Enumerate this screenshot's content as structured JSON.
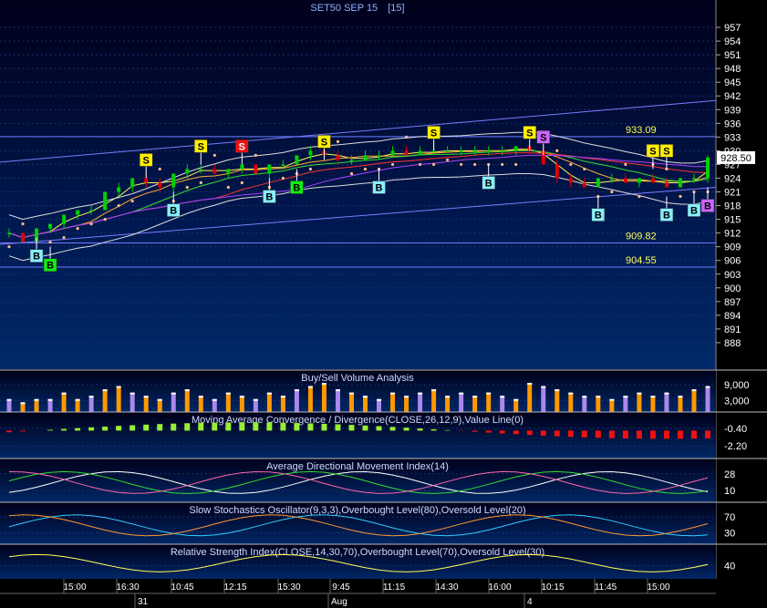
{
  "chart_data": {
    "type": "candlestick",
    "title": "SET50 SEP 15",
    "interval": "[15]",
    "last_price": "928.50",
    "price_axis": {
      "range": [
        884,
        960
      ],
      "ticks": [
        "957",
        "954",
        "951",
        "948",
        "945",
        "942",
        "939",
        "936",
        "933",
        "930",
        "927",
        "924",
        "921",
        "918",
        "915",
        "912",
        "909",
        "906",
        "903",
        "900",
        "897",
        "894",
        "891",
        "888"
      ]
    },
    "levels": [
      {
        "label": "933.09",
        "value": 933.09
      },
      {
        "label": "909.82",
        "value": 909.82
      },
      {
        "label": "904.55",
        "value": 904.55
      }
    ],
    "trend_channel": {
      "upper": [
        [
          0,
          927.5
        ],
        [
          1,
          941
        ]
      ],
      "lower": [
        [
          0,
          909.5
        ],
        [
          1,
          922
        ]
      ]
    },
    "time_ticks": [
      "15:00",
      "16:30",
      "10:45",
      "12:15",
      "15:30",
      "9:45",
      "11:15",
      "14:30",
      "16:00",
      "10:15",
      "11:45",
      "15:00"
    ],
    "date_ticks": [
      "31",
      "Aug",
      "4"
    ],
    "signals": [
      {
        "type": "B",
        "bar": 2,
        "price": 907,
        "style": "cyan"
      },
      {
        "type": "B",
        "bar": 3,
        "price": 905,
        "style": "green"
      },
      {
        "type": "S",
        "bar": 10,
        "price": 928,
        "style": "yellow"
      },
      {
        "type": "B",
        "bar": 12,
        "price": 917,
        "style": "cyan"
      },
      {
        "type": "S",
        "bar": 14,
        "price": 931,
        "style": "yellow"
      },
      {
        "type": "S",
        "bar": 17,
        "price": 931,
        "style": "red"
      },
      {
        "type": "B",
        "bar": 19,
        "price": 920,
        "style": "cyan"
      },
      {
        "type": "B",
        "bar": 21,
        "price": 922,
        "style": "green"
      },
      {
        "type": "S",
        "bar": 23,
        "price": 932,
        "style": "yellow"
      },
      {
        "type": "B",
        "bar": 27,
        "price": 922,
        "style": "cyan"
      },
      {
        "type": "S",
        "bar": 31,
        "price": 934,
        "style": "yellow"
      },
      {
        "type": "B",
        "bar": 35,
        "price": 923,
        "style": "cyan"
      },
      {
        "type": "S",
        "bar": 38,
        "price": 934,
        "style": "yellow"
      },
      {
        "type": "S",
        "bar": 39,
        "price": 933,
        "style": "purple"
      },
      {
        "type": "B",
        "bar": 43,
        "price": 916,
        "style": "cyan"
      },
      {
        "type": "S",
        "bar": 47,
        "price": 930,
        "style": "yellow"
      },
      {
        "type": "S",
        "bar": 48,
        "price": 930,
        "style": "yellow"
      },
      {
        "type": "B",
        "bar": 48,
        "price": 916,
        "style": "cyan"
      },
      {
        "type": "B",
        "bar": 50,
        "price": 917,
        "style": "cyan"
      },
      {
        "type": "B",
        "bar": 51,
        "price": 918,
        "style": "purple"
      }
    ],
    "ohlc": [
      [
        912,
        913,
        911,
        912
      ],
      [
        912,
        912,
        910,
        910
      ],
      [
        910,
        913,
        910,
        913
      ],
      [
        913,
        914,
        912,
        914
      ],
      [
        914,
        916,
        913,
        916
      ],
      [
        916,
        917,
        915,
        917
      ],
      [
        917,
        918,
        916,
        917
      ],
      [
        917,
        921,
        917,
        921
      ],
      [
        921,
        923,
        920,
        922
      ],
      [
        922,
        924,
        921,
        924
      ],
      [
        924,
        925,
        922,
        923
      ],
      [
        923,
        924,
        921,
        922
      ],
      [
        922,
        925,
        921,
        925
      ],
      [
        925,
        927,
        924,
        926
      ],
      [
        926,
        927,
        925,
        926
      ],
      [
        926,
        927,
        925,
        925
      ],
      [
        925,
        926,
        924,
        926
      ],
      [
        926,
        927,
        925,
        927
      ],
      [
        927,
        927,
        925,
        925
      ],
      [
        925,
        927,
        924,
        927
      ],
      [
        927,
        928,
        926,
        927
      ],
      [
        927,
        929,
        927,
        929
      ],
      [
        929,
        931,
        928,
        930
      ],
      [
        930,
        931,
        929,
        929
      ],
      [
        929,
        930,
        927,
        928
      ],
      [
        928,
        929,
        927,
        928
      ],
      [
        928,
        930,
        928,
        929
      ],
      [
        929,
        930,
        928,
        929
      ],
      [
        929,
        931,
        929,
        930
      ],
      [
        930,
        931,
        929,
        929
      ],
      [
        929,
        931,
        929,
        930
      ],
      [
        930,
        932,
        929,
        930
      ],
      [
        930,
        931,
        930,
        930
      ],
      [
        930,
        931,
        929,
        930
      ],
      [
        930,
        931,
        929,
        930
      ],
      [
        930,
        931,
        929,
        930
      ],
      [
        930,
        931,
        929,
        930
      ],
      [
        930,
        931,
        929,
        931
      ],
      [
        931,
        931,
        929,
        930
      ],
      [
        930,
        931,
        928,
        927
      ],
      [
        927,
        928,
        923,
        924
      ],
      [
        924,
        925,
        922,
        923
      ],
      [
        923,
        924,
        922,
        922
      ],
      [
        922,
        924,
        922,
        924
      ],
      [
        924,
        925,
        923,
        924
      ],
      [
        924,
        925,
        923,
        923
      ],
      [
        923,
        924,
        922,
        924
      ],
      [
        924,
        925,
        923,
        923
      ],
      [
        923,
        924,
        922,
        922
      ],
      [
        922,
        924,
        922,
        924
      ],
      [
        924,
        925,
        923,
        924
      ],
      [
        924,
        929,
        923,
        928.5
      ]
    ],
    "volume": [
      4,
      3,
      4,
      4,
      6,
      4,
      5,
      7,
      8,
      6,
      5,
      4,
      6,
      7,
      5,
      4,
      6,
      5,
      4,
      6,
      5,
      7,
      8,
      9,
      7,
      6,
      5,
      4,
      6,
      5,
      6,
      7,
      5,
      6,
      5,
      6,
      5,
      4,
      9,
      8,
      7,
      6,
      5,
      5,
      4,
      5,
      6,
      5,
      6,
      5,
      7,
      8
    ],
    "panels": [
      {
        "title": "Buy/Sell Volume Analysis",
        "ticks": [
          "9,000",
          "3,000"
        ]
      },
      {
        "title": "Moving Average Convergence / Divergence(CLOSE,26,12,9),Value Line(0)",
        "ticks": [
          "-0.40",
          "-2.20"
        ]
      },
      {
        "title": "Average Directional Movement Index(14)",
        "ticks": [
          "28",
          "10"
        ]
      },
      {
        "title": "Slow Stochastics Oscillator(9,3,3),Overbought Level(80),Oversold Level(20)",
        "ticks": [
          "70",
          "30"
        ]
      },
      {
        "title": "Relative Strength Index(CLOSE,14,30,70),Overbought Level(70),Oversold Level(30)",
        "ticks": [
          "40"
        ]
      }
    ],
    "colors": {
      "bg_top": "#00001a",
      "bg_bottom": "#002a6a",
      "up": "#00d000",
      "down": "#e00000",
      "level_line": "#6a7cff",
      "level_text": "#ffff55",
      "grid": "#1c2f6a"
    }
  }
}
